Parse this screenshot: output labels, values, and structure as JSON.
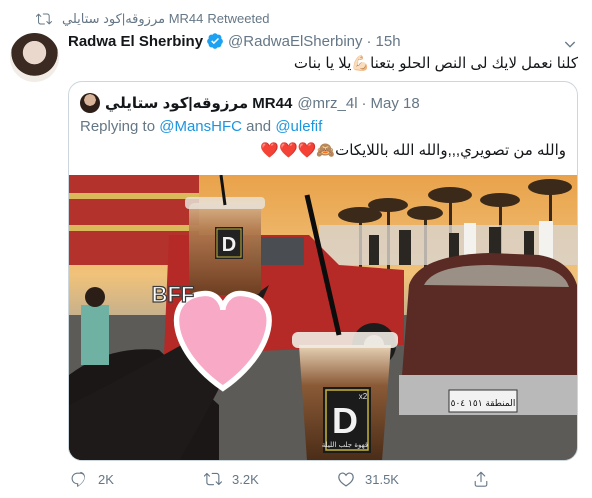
{
  "retweet": {
    "retweeter": "مرزوقه|كود ستايلي MR44",
    "label": "Retweeted",
    "icon": "retweet-icon"
  },
  "tweet": {
    "author_name": "Radwa El Sherbiny",
    "author_handle": "@RadwaElSherbiny",
    "separator": "·",
    "time": "15h",
    "text": "كلنا نعمل لايك لى النص الحلو بتعنا💪🏻يلا يا بنات"
  },
  "quoted": {
    "author_name": "مرزوقه|كود ستايلي MR44",
    "author_handle": "@mrz_4l",
    "separator": "·",
    "date": "May 18",
    "replying_prefix": "Replying to ",
    "mention_1": "@MansHFC",
    "replying_and": " and ",
    "mention_2": "@ulefif",
    "text": "والله من تصويري,,,والله الله باللايكات🙈❤️❤️❤️",
    "image": {
      "sticker_text": "BFF",
      "cup_logo": "D",
      "cup_superscript": "x2",
      "cup_caption": "قهوة جلب الليلة",
      "plate_text": "المنطقة ١٥١ ٥٠٤"
    }
  },
  "actions": {
    "reply_count": "2K",
    "retweet_count": "3.2K",
    "like_count": "31.5K"
  },
  "colors": {
    "link": "#1b95e0",
    "muted": "#657786",
    "border": "#ccd6dd",
    "verified": "#1da1f2"
  }
}
